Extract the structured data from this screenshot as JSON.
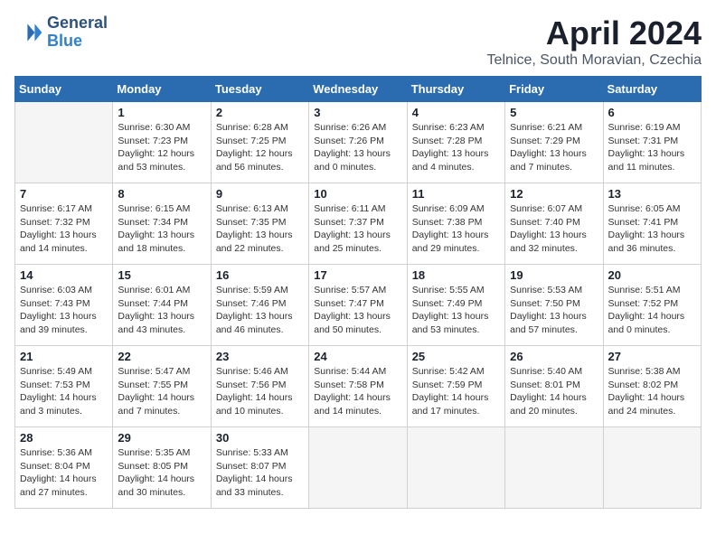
{
  "header": {
    "logo_line1": "General",
    "logo_line2": "Blue",
    "month": "April 2024",
    "location": "Telnice, South Moravian, Czechia"
  },
  "weekdays": [
    "Sunday",
    "Monday",
    "Tuesday",
    "Wednesday",
    "Thursday",
    "Friday",
    "Saturday"
  ],
  "weeks": [
    [
      {
        "day": "",
        "info": ""
      },
      {
        "day": "1",
        "info": "Sunrise: 6:30 AM\nSunset: 7:23 PM\nDaylight: 12 hours\nand 53 minutes."
      },
      {
        "day": "2",
        "info": "Sunrise: 6:28 AM\nSunset: 7:25 PM\nDaylight: 12 hours\nand 56 minutes."
      },
      {
        "day": "3",
        "info": "Sunrise: 6:26 AM\nSunset: 7:26 PM\nDaylight: 13 hours\nand 0 minutes."
      },
      {
        "day": "4",
        "info": "Sunrise: 6:23 AM\nSunset: 7:28 PM\nDaylight: 13 hours\nand 4 minutes."
      },
      {
        "day": "5",
        "info": "Sunrise: 6:21 AM\nSunset: 7:29 PM\nDaylight: 13 hours\nand 7 minutes."
      },
      {
        "day": "6",
        "info": "Sunrise: 6:19 AM\nSunset: 7:31 PM\nDaylight: 13 hours\nand 11 minutes."
      }
    ],
    [
      {
        "day": "7",
        "info": "Sunrise: 6:17 AM\nSunset: 7:32 PM\nDaylight: 13 hours\nand 14 minutes."
      },
      {
        "day": "8",
        "info": "Sunrise: 6:15 AM\nSunset: 7:34 PM\nDaylight: 13 hours\nand 18 minutes."
      },
      {
        "day": "9",
        "info": "Sunrise: 6:13 AM\nSunset: 7:35 PM\nDaylight: 13 hours\nand 22 minutes."
      },
      {
        "day": "10",
        "info": "Sunrise: 6:11 AM\nSunset: 7:37 PM\nDaylight: 13 hours\nand 25 minutes."
      },
      {
        "day": "11",
        "info": "Sunrise: 6:09 AM\nSunset: 7:38 PM\nDaylight: 13 hours\nand 29 minutes."
      },
      {
        "day": "12",
        "info": "Sunrise: 6:07 AM\nSunset: 7:40 PM\nDaylight: 13 hours\nand 32 minutes."
      },
      {
        "day": "13",
        "info": "Sunrise: 6:05 AM\nSunset: 7:41 PM\nDaylight: 13 hours\nand 36 minutes."
      }
    ],
    [
      {
        "day": "14",
        "info": "Sunrise: 6:03 AM\nSunset: 7:43 PM\nDaylight: 13 hours\nand 39 minutes."
      },
      {
        "day": "15",
        "info": "Sunrise: 6:01 AM\nSunset: 7:44 PM\nDaylight: 13 hours\nand 43 minutes."
      },
      {
        "day": "16",
        "info": "Sunrise: 5:59 AM\nSunset: 7:46 PM\nDaylight: 13 hours\nand 46 minutes."
      },
      {
        "day": "17",
        "info": "Sunrise: 5:57 AM\nSunset: 7:47 PM\nDaylight: 13 hours\nand 50 minutes."
      },
      {
        "day": "18",
        "info": "Sunrise: 5:55 AM\nSunset: 7:49 PM\nDaylight: 13 hours\nand 53 minutes."
      },
      {
        "day": "19",
        "info": "Sunrise: 5:53 AM\nSunset: 7:50 PM\nDaylight: 13 hours\nand 57 minutes."
      },
      {
        "day": "20",
        "info": "Sunrise: 5:51 AM\nSunset: 7:52 PM\nDaylight: 14 hours\nand 0 minutes."
      }
    ],
    [
      {
        "day": "21",
        "info": "Sunrise: 5:49 AM\nSunset: 7:53 PM\nDaylight: 14 hours\nand 3 minutes."
      },
      {
        "day": "22",
        "info": "Sunrise: 5:47 AM\nSunset: 7:55 PM\nDaylight: 14 hours\nand 7 minutes."
      },
      {
        "day": "23",
        "info": "Sunrise: 5:46 AM\nSunset: 7:56 PM\nDaylight: 14 hours\nand 10 minutes."
      },
      {
        "day": "24",
        "info": "Sunrise: 5:44 AM\nSunset: 7:58 PM\nDaylight: 14 hours\nand 14 minutes."
      },
      {
        "day": "25",
        "info": "Sunrise: 5:42 AM\nSunset: 7:59 PM\nDaylight: 14 hours\nand 17 minutes."
      },
      {
        "day": "26",
        "info": "Sunrise: 5:40 AM\nSunset: 8:01 PM\nDaylight: 14 hours\nand 20 minutes."
      },
      {
        "day": "27",
        "info": "Sunrise: 5:38 AM\nSunset: 8:02 PM\nDaylight: 14 hours\nand 24 minutes."
      }
    ],
    [
      {
        "day": "28",
        "info": "Sunrise: 5:36 AM\nSunset: 8:04 PM\nDaylight: 14 hours\nand 27 minutes."
      },
      {
        "day": "29",
        "info": "Sunrise: 5:35 AM\nSunset: 8:05 PM\nDaylight: 14 hours\nand 30 minutes."
      },
      {
        "day": "30",
        "info": "Sunrise: 5:33 AM\nSunset: 8:07 PM\nDaylight: 14 hours\nand 33 minutes."
      },
      {
        "day": "",
        "info": ""
      },
      {
        "day": "",
        "info": ""
      },
      {
        "day": "",
        "info": ""
      },
      {
        "day": "",
        "info": ""
      }
    ]
  ]
}
